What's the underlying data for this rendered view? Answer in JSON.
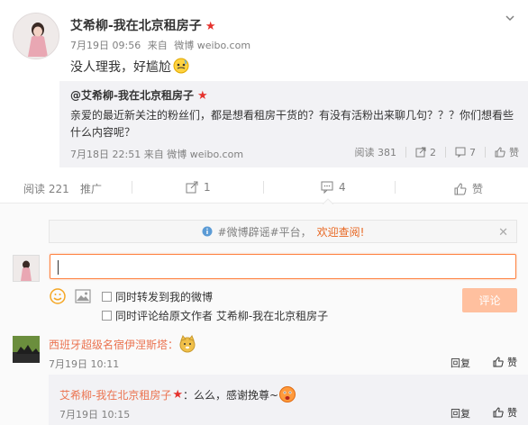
{
  "post": {
    "author": "艾希柳-我在北京租房子",
    "date": "7月19日 09:56",
    "source_prefix": "来自",
    "source": "微博 weibo.com",
    "text": "没人理我，好尴尬"
  },
  "repost": {
    "author": "@艾希柳-我在北京租房子",
    "text": "亲爱的最近新关注的粉丝们，都是想看租房干货的？有没有活粉出来聊几句？？？你们想看些什么内容呢？",
    "date": "7月18日 22:51",
    "source_prefix": "来自",
    "source": "微博 weibo.com",
    "views": "阅读 381",
    "reposts": "2",
    "comments": "7",
    "likes": "赞"
  },
  "actions": {
    "reads": "阅读 221",
    "promote": "推广",
    "repost": "1",
    "comment": "4",
    "like": "赞"
  },
  "notice": {
    "text": "#微博辟谣#平台，",
    "highlight": "欢迎查阅!"
  },
  "composer": {
    "option1": "同时转发到我的微博",
    "option2": "同时评论给原文作者 艾希柳-我在北京租房子",
    "submit": "评论"
  },
  "comment": {
    "name": "西班牙超级名宿伊涅斯塔：",
    "date": "7月19日 10:11",
    "reply": "回复",
    "like": "赞"
  },
  "reply": {
    "name": "艾希柳-我在北京租房子",
    "text": "：么么，感谢挽尊~",
    "date": "7月19日 10:15",
    "reply": "回复",
    "like": "赞"
  },
  "colors": {
    "accent": "#eb7350",
    "input_border": "#ff8140",
    "submit_disabled": "#ffc09f",
    "star": "#e5322d"
  }
}
